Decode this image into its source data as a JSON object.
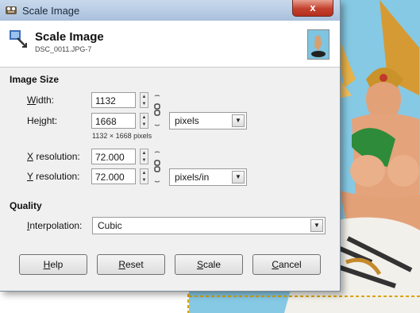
{
  "window": {
    "title": "Scale Image",
    "close_glyph": "x"
  },
  "header": {
    "title": "Scale Image",
    "subtitle": "DSC_0011.JPG-7",
    "thumbnail_icon": "image-thumbnail-icon"
  },
  "image_size": {
    "section_title": "Image Size",
    "width_label_mnemonic": "W",
    "width_label_rest": "idth:",
    "width_value": "1132",
    "height_label_pre": "He",
    "height_label_mnemonic": "i",
    "height_label_rest": "ght:",
    "height_value": "1668",
    "size_unit": "pixels",
    "size_note": "1132 × 1668 pixels",
    "xres_label_mnemonic": "X",
    "xres_label_rest": " resolution:",
    "xres_value": "72.000",
    "yres_label_mnemonic": "Y",
    "yres_label_rest": " resolution:",
    "yres_value": "72.000",
    "res_unit": "pixels/in"
  },
  "quality": {
    "section_title": "Quality",
    "interp_label_mnemonic": "I",
    "interp_label_rest": "nterpolation:",
    "interp_value": "Cubic"
  },
  "buttons": {
    "help_mnemonic": "H",
    "help_rest": "elp",
    "reset_mnemonic": "R",
    "reset_rest": "eset",
    "scale_mnemonic": "S",
    "scale_rest": "cale",
    "cancel_mnemonic": "C",
    "cancel_rest": "ancel"
  },
  "colors": {
    "titlebar": "#b7cbe3",
    "close": "#c4402e",
    "canvas_sky": "#8ccde6"
  }
}
